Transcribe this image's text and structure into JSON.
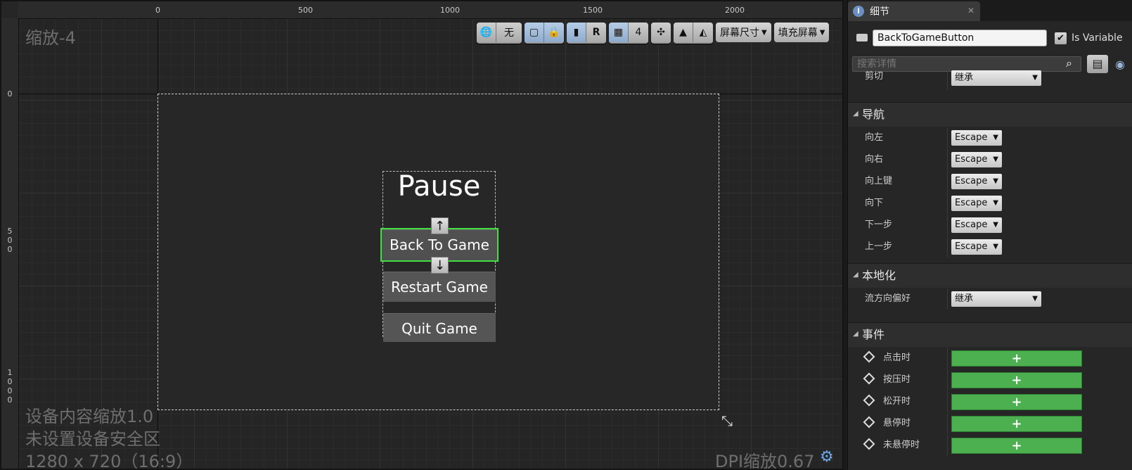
{
  "designer": {
    "zoom_label": "缩放-4",
    "ruler_top": [
      "0",
      "500",
      "1000",
      "1500",
      "2000"
    ],
    "ruler_left": [
      "0",
      "5\n0\n0",
      "1\n0\n0\n0"
    ],
    "info_scale": "设备内容缩放1.0",
    "info_safe_zone": "未设置设备安全区",
    "info_resolution": "1280 x 720（16:9）",
    "dpi_label": "DPI缩放0.67",
    "toolbar": {
      "localization_none": "无",
      "snap_value": "4",
      "r_label": "R",
      "screen_size": "屏幕尺寸",
      "fill_screen": "填充屏幕"
    },
    "widget": {
      "title": "Pause",
      "buttons": [
        "Back To Game",
        "Restart Game",
        "Quit Game"
      ],
      "nav_up": "↑",
      "nav_down": "↓"
    }
  },
  "details": {
    "tab_label": "细节",
    "widget_name": "BackToGameButton",
    "is_variable_label": "Is Variable",
    "is_variable": true,
    "search_placeholder": "搜索详情",
    "clipping": {
      "label": "剪切",
      "value": "继承"
    },
    "sections": {
      "navigation": "导航",
      "localization": "本地化",
      "events": "事件"
    },
    "navigation": [
      {
        "label": "向左",
        "value": "Escape"
      },
      {
        "label": "向右",
        "value": "Escape"
      },
      {
        "label": "向上键",
        "value": "Escape"
      },
      {
        "label": "向下",
        "value": "Escape"
      },
      {
        "label": "下一步",
        "value": "Escape"
      },
      {
        "label": "上一步",
        "value": "Escape"
      }
    ],
    "flow_direction": {
      "label": "流方向偏好",
      "value": "继承"
    },
    "events": [
      "点击时",
      "按压时",
      "松开时",
      "悬停时",
      "未悬停时"
    ],
    "add_symbol": "+"
  }
}
